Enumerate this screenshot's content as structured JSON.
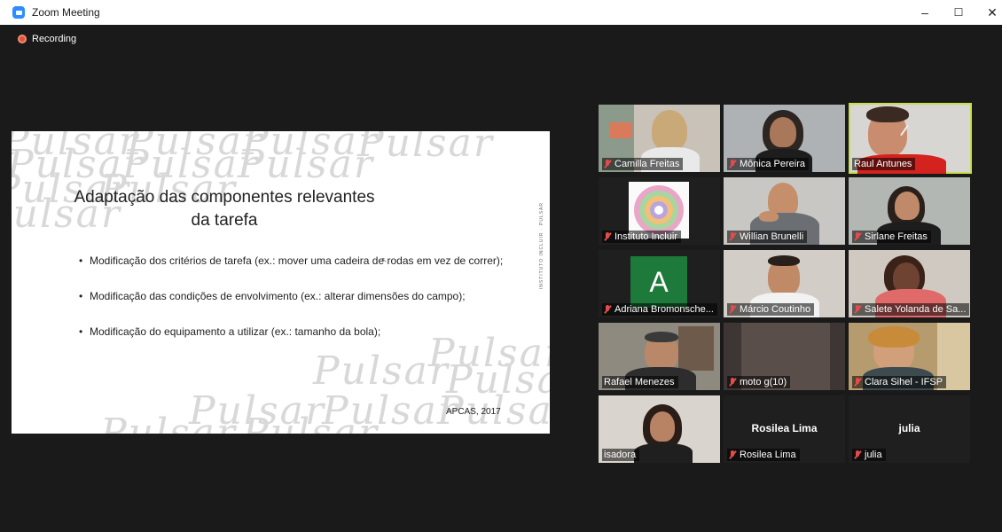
{
  "window": {
    "title": "Zoom Meeting",
    "minimize": "–",
    "maximize": "☐",
    "close": "✕"
  },
  "status": {
    "recording": "Recording"
  },
  "slide": {
    "watermark": "Pulsar",
    "title_line1": "Adaptação das componentes relevantes",
    "title_line2": "da tarefa",
    "bullets": [
      "Modificação dos critérios de tarefa (ex.: mover uma cadeira de rodas em vez de correr);",
      "Modificação das condições de envolvimento (ex.: alterar dimensões do campo);",
      "Modificação do equipamento a utilizar (ex.: tamanho da bola);"
    ],
    "side_text": "INSTITUTO INCLUIR · PULSAR",
    "footer": "APCAS, 2017"
  },
  "participants": [
    {
      "name": "Camilla Freitas",
      "muted": true
    },
    {
      "name": "Mônica Pereira",
      "muted": true
    },
    {
      "name": "Raul Antunes",
      "muted": false,
      "active_speaker": true
    },
    {
      "name": "Instituto Incluir",
      "muted": true
    },
    {
      "name": "Willian Brunelli",
      "muted": true
    },
    {
      "name": "Sirlane Freitas",
      "muted": true
    },
    {
      "name": "Adriana Bromonsche...",
      "muted": true,
      "avatar_letter": "A"
    },
    {
      "name": "Márcio Coutinho",
      "muted": true
    },
    {
      "name": "Salete Yolanda de Sa...",
      "muted": true
    },
    {
      "name": "Rafael Menezes",
      "muted": false
    },
    {
      "name": "moto g(10)",
      "muted": true
    },
    {
      "name": "Clara Sihel - IFSP",
      "muted": true
    },
    {
      "name": "isadora",
      "muted": false
    },
    {
      "name": "Rosilea Lima",
      "muted": true,
      "display_name": "Rosilea Lima"
    },
    {
      "name": "julia",
      "muted": true,
      "display_name": "julia"
    }
  ],
  "colors": {
    "active_speaker_border": "#c8de4e",
    "mute_icon": "#e54b4b",
    "recording_dot": "#e0523c",
    "background": "#1a1a1a"
  }
}
